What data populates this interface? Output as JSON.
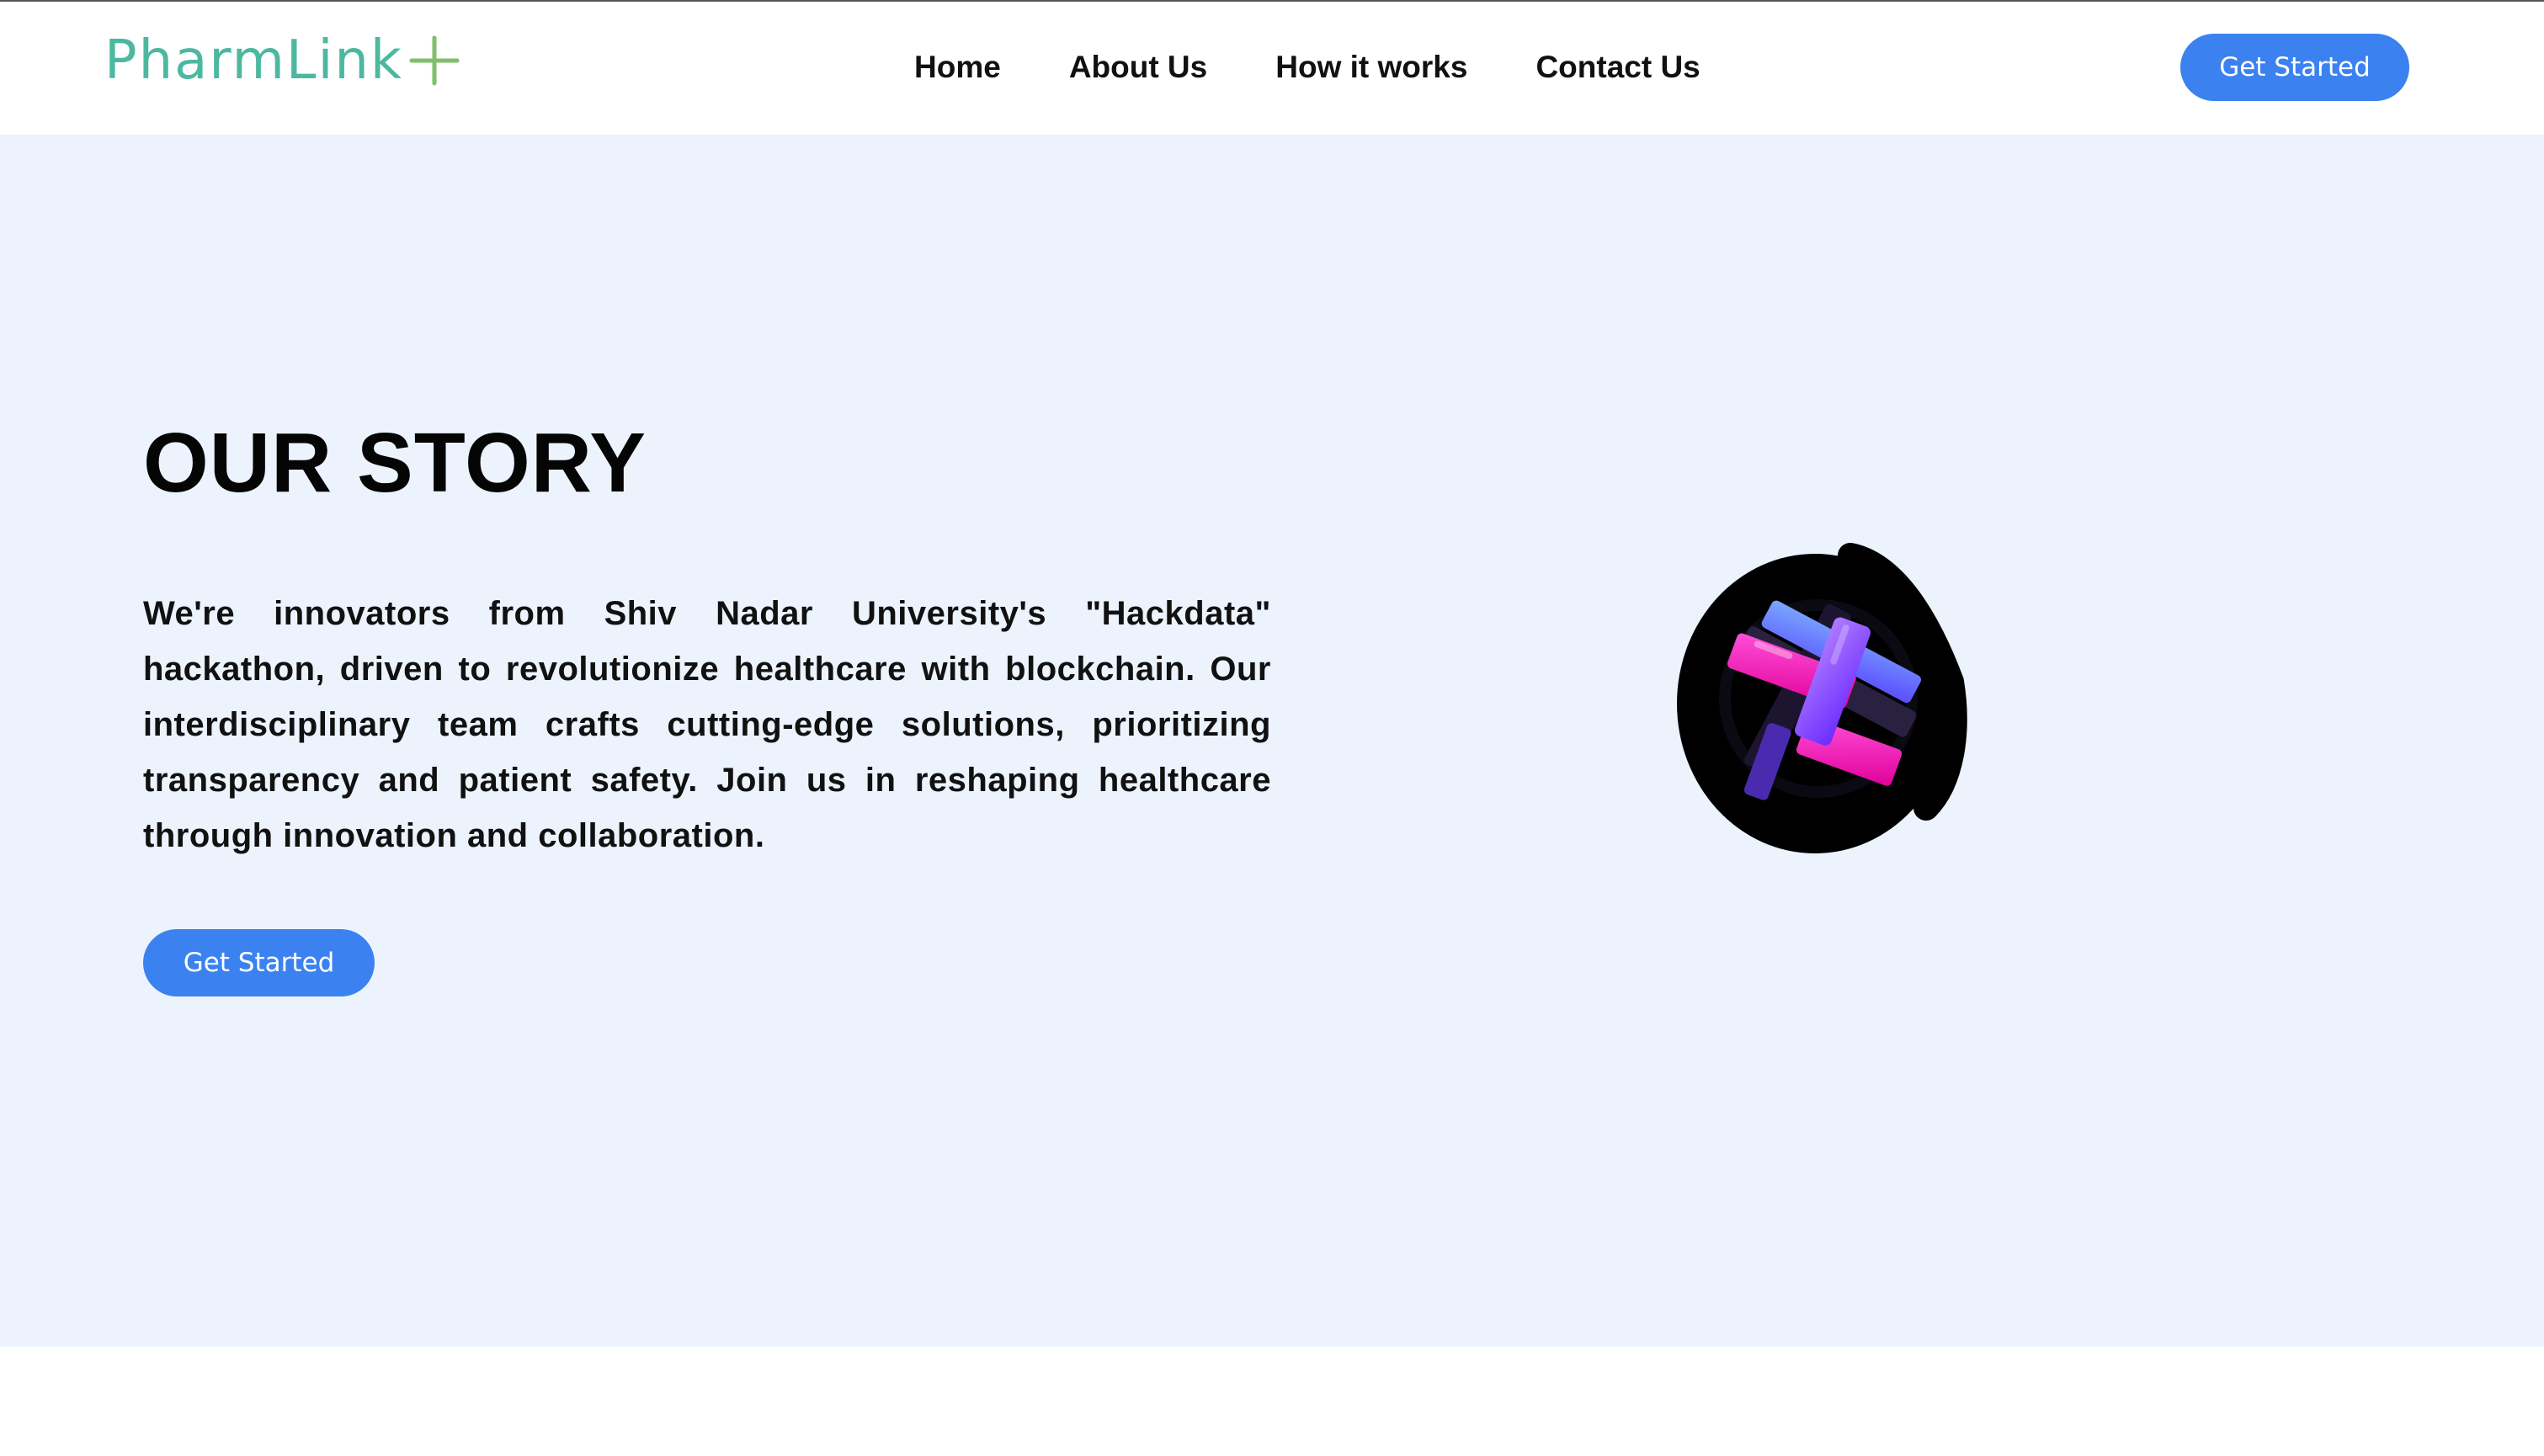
{
  "header": {
    "logo": {
      "text": "PharmLink",
      "text_color": "#4db8a0",
      "plus_color": "#7fbf6a"
    },
    "nav": [
      {
        "label": "Home"
      },
      {
        "label": "About Us"
      },
      {
        "label": "How it works"
      },
      {
        "label": "Contact Us"
      }
    ],
    "cta_label": "Get Started"
  },
  "hero": {
    "title": "OUR STORY",
    "paragraph": "We're innovators from Shiv Nadar University's \"Hackdata\" hackathon, driven to revolutionize healthcare with blockchain. Our interdisciplinary team crafts cutting-edge solutions, prioritizing transparency and patient safety. Join us in reshaping healthcare through innovation and collaboration.",
    "cta_label": "Get Started",
    "background": "#ecf3fd",
    "illustration_icon": "medical-cross-3d-icon"
  },
  "colors": {
    "accent": "#3b82f0",
    "text": "#111111"
  }
}
